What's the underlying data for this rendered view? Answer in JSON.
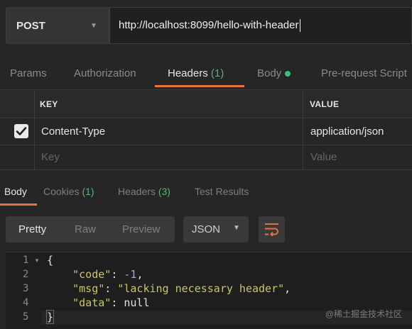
{
  "request": {
    "method": "POST",
    "url": "http://localhost:8099/hello-with-header"
  },
  "request_tabs": [
    {
      "label": "Params"
    },
    {
      "label": "Authorization"
    },
    {
      "label": "Headers",
      "count": "(1)"
    },
    {
      "label": "Body"
    },
    {
      "label": "Pre-request Script"
    }
  ],
  "headers_table": {
    "columns": [
      "KEY",
      "VALUE"
    ],
    "rows": [
      {
        "checked": true,
        "key": "Content-Type",
        "value": "application/json"
      }
    ],
    "placeholder_key": "Key",
    "placeholder_value": "Value"
  },
  "response_tabs": [
    {
      "label": "Body"
    },
    {
      "label": "Cookies",
      "count": "(1)"
    },
    {
      "label": "Headers",
      "count": "(3)"
    },
    {
      "label": "Test Results"
    }
  ],
  "view_modes": [
    "Pretty",
    "Raw",
    "Preview"
  ],
  "format": "JSON",
  "code": {
    "line_numbers": [
      "1",
      "2",
      "3",
      "4",
      "5"
    ],
    "open_brace": "{",
    "close_brace": "}",
    "fields": [
      {
        "key": "\"code\"",
        "value": "-1",
        "suffix": ","
      },
      {
        "key": "\"msg\"",
        "value": "\"lacking necessary header\"",
        "suffix": ","
      },
      {
        "key": "\"data\"",
        "value": "null",
        "suffix": ""
      }
    ]
  },
  "watermark": "@稀土掘金技术社区",
  "colors": {
    "accent": "#e8723c",
    "count": "#5fb07a",
    "body_dot": "#3fbf7f"
  }
}
